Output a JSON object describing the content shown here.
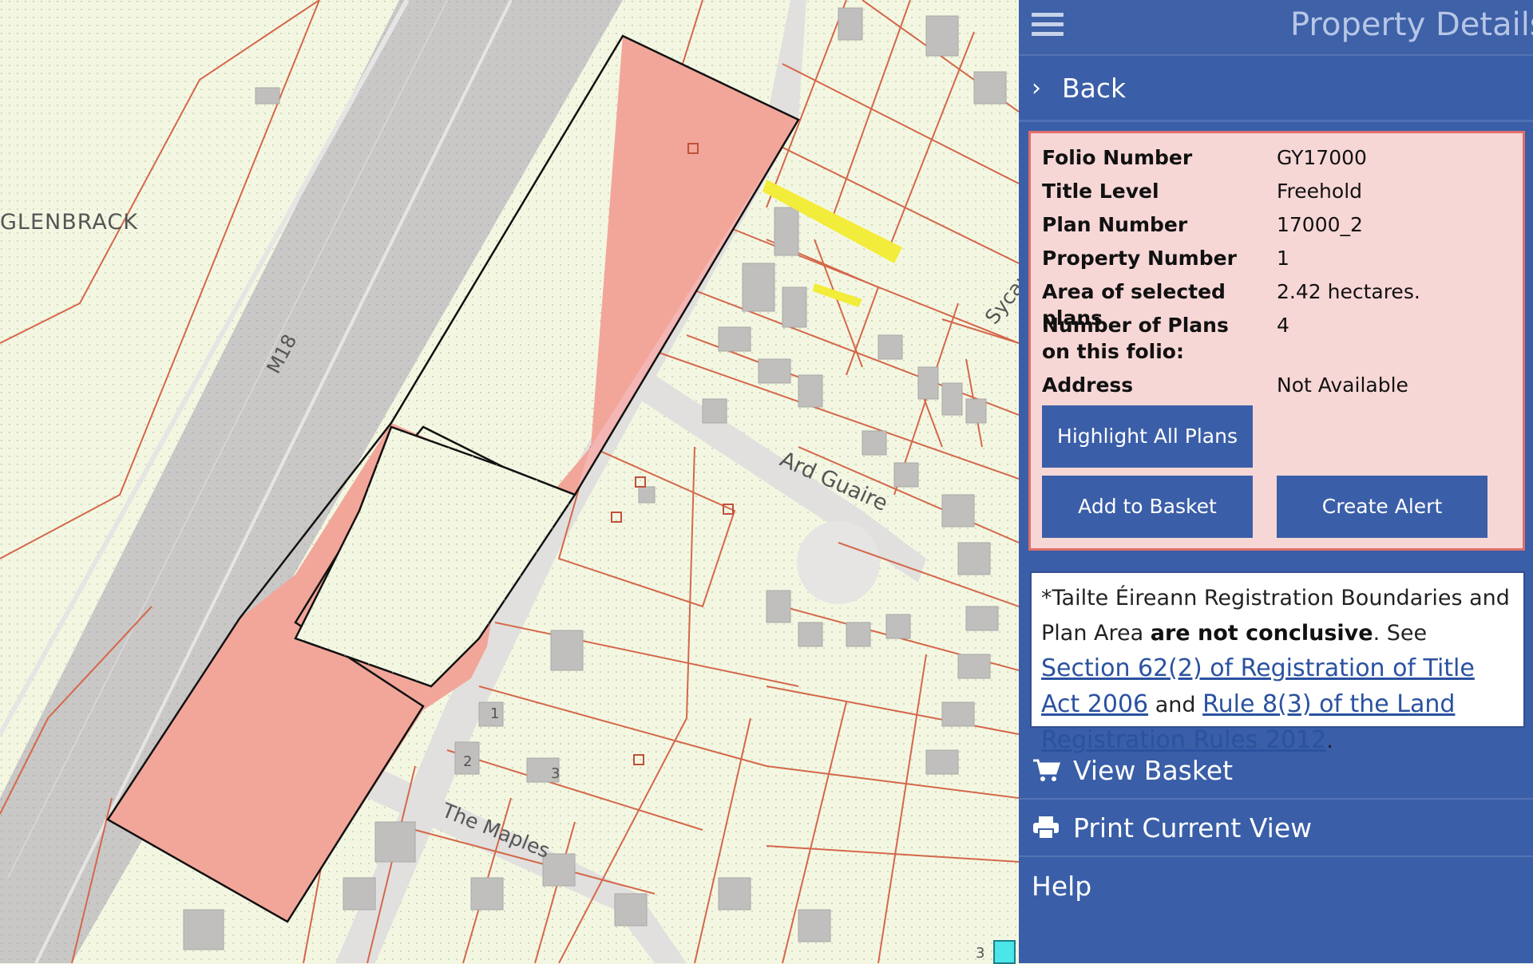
{
  "map": {
    "labels": {
      "glenbrack": "GLENBRACK",
      "m18": "M18",
      "ard_guaire": "Ard Guaire",
      "the_maples": "The Maples",
      "sycamore_partial": "Sycam",
      "house_1": "1",
      "house_2": "2",
      "house_3": "3",
      "house_3b": "3"
    },
    "colors": {
      "background": "#f3f7e2",
      "road": "#dedddb",
      "motorway": "#c9c8c6",
      "parcel_line": "#d4674a",
      "selected_fill": "#f2a69a",
      "selected_strip": "#f3b6b4",
      "building": "#c0bfbe",
      "highlight_yellow": "#f2ec3a"
    }
  },
  "panel": {
    "title": "Property Details",
    "back_label": "Back",
    "details": [
      {
        "label": "Folio Number",
        "value": "GY17000"
      },
      {
        "label": "Title Level",
        "value": "Freehold"
      },
      {
        "label": "Plan Number",
        "value": "17000_2"
      },
      {
        "label": "Property Number",
        "value": "1"
      },
      {
        "label": "Area of selected plans",
        "value": "2.42 hectares."
      },
      {
        "label": "Number of Plans on this folio:",
        "value": "4"
      },
      {
        "label": "Address",
        "value": "Not Available"
      }
    ],
    "buttons": {
      "highlight": "Highlight All Plans",
      "add_basket": "Add to Basket",
      "create_alert": "Create Alert"
    },
    "notice": {
      "prefix": "*Tailte Éireann Registration Boundaries and Plan Area ",
      "bold": "are not conclusive",
      "see": ". See ",
      "link1": "Section 62(2) of Registration of Title Act 2006",
      "and": " and ",
      "link2": "Rule 8(3) of the Land Registration Rules 2012",
      "end": "."
    },
    "menu": {
      "view_basket": "View Basket",
      "print_view": "Print Current View",
      "help": "Help"
    },
    "colors": {
      "panel_bg": "#3a5ea7",
      "details_bg": "#f7d7d6",
      "details_border": "#e06e6a",
      "button_bg": "#3b5ea8"
    }
  }
}
